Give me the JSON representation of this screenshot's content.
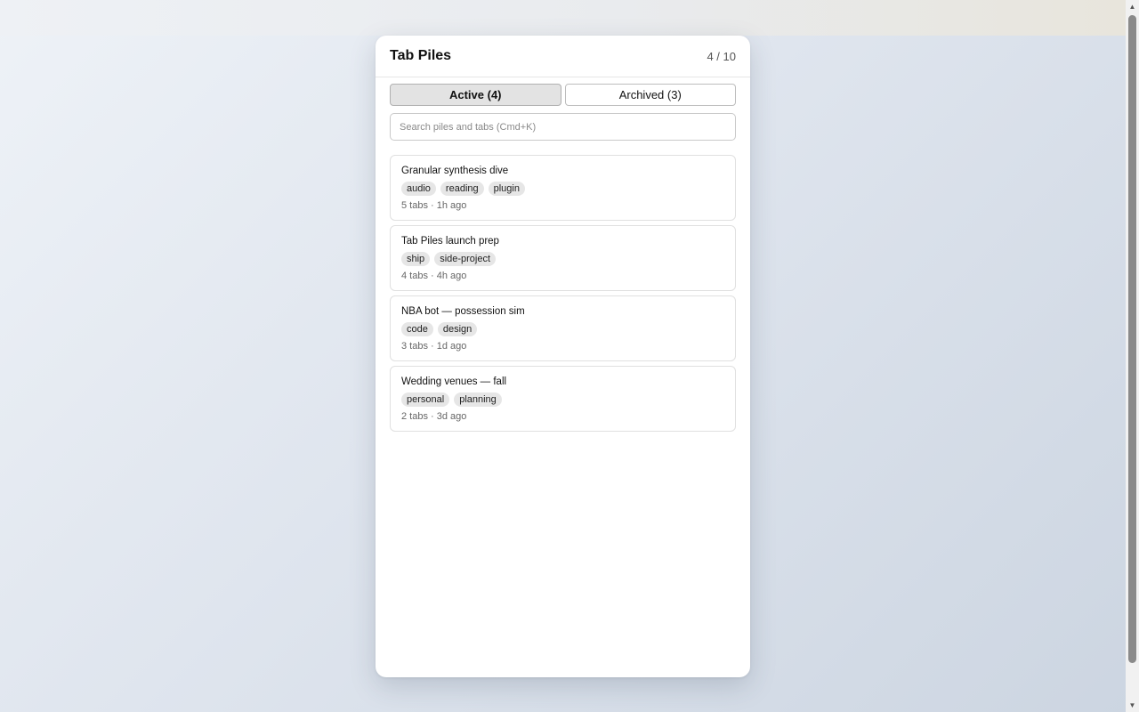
{
  "panel": {
    "title": "Tab Piles",
    "count": "4 / 10"
  },
  "tabs": [
    {
      "label": "Active (4)",
      "active": true
    },
    {
      "label": "Archived (3)",
      "active": false
    }
  ],
  "search": {
    "placeholder": "Search piles and tabs (Cmd+K)",
    "value": ""
  },
  "piles": [
    {
      "name": "Granular synthesis dive",
      "tags": [
        "audio",
        "reading",
        "plugin"
      ],
      "meta": "5 tabs · 1h ago"
    },
    {
      "name": "Tab Piles launch prep",
      "tags": [
        "ship",
        "side-project"
      ],
      "meta": "4 tabs · 4h ago"
    },
    {
      "name": "NBA bot — possession sim",
      "tags": [
        "code",
        "design"
      ],
      "meta": "3 tabs · 1d ago"
    },
    {
      "name": "Wedding venues — fall",
      "tags": [
        "personal",
        "planning"
      ],
      "meta": "2 tabs · 3d ago"
    }
  ],
  "icons": {
    "scroll_up": "scroll-up-arrow-icon",
    "scroll_down": "scroll-down-arrow-icon"
  }
}
